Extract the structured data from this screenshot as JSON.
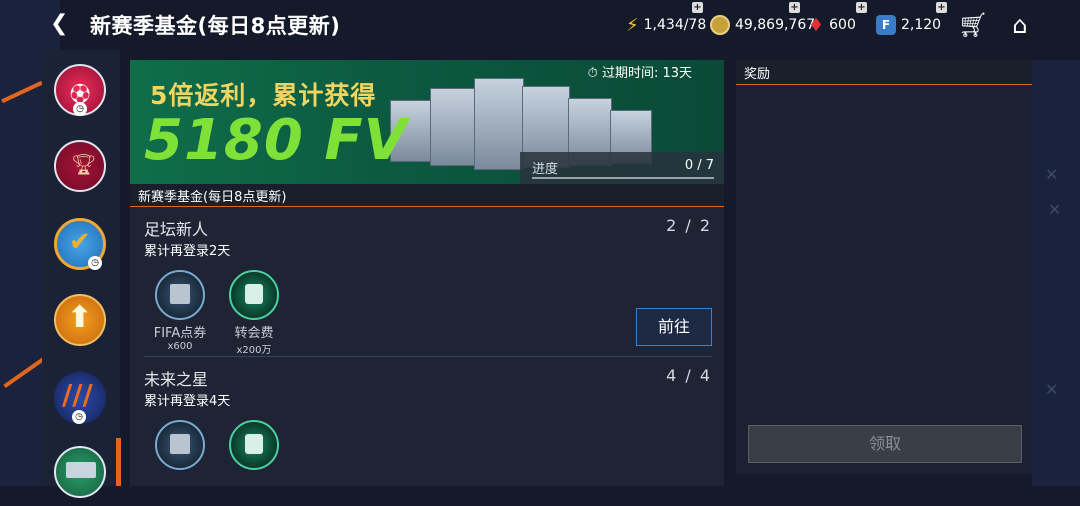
{
  "header": {
    "title": "新赛季基金(每日8点更新)",
    "energy": "1,434/78",
    "coins": "49,869,767",
    "gems": "600",
    "fp": "2,120"
  },
  "banner": {
    "headline": "5倍返利，累计获得",
    "amount": "5180 FV",
    "expire": "过期时间: 13天",
    "progress_label": "进度",
    "progress_value": "0 / 7",
    "progress_fraction": 0
  },
  "section_title": "新赛季基金(每日8点更新)",
  "tasks": [
    {
      "name": "足坛新人",
      "desc": "累计再登录2天",
      "count": "2 / 2",
      "rewards": [
        {
          "label": "FIFA点券",
          "qty": "x600"
        },
        {
          "label": "转会费",
          "qty": "x200万"
        }
      ],
      "button": "前往"
    },
    {
      "name": "未来之星",
      "desc": "累计再登录4天",
      "count": "4 / 4"
    }
  ],
  "reward_panel": {
    "title": "奖励",
    "claim": "领取"
  }
}
